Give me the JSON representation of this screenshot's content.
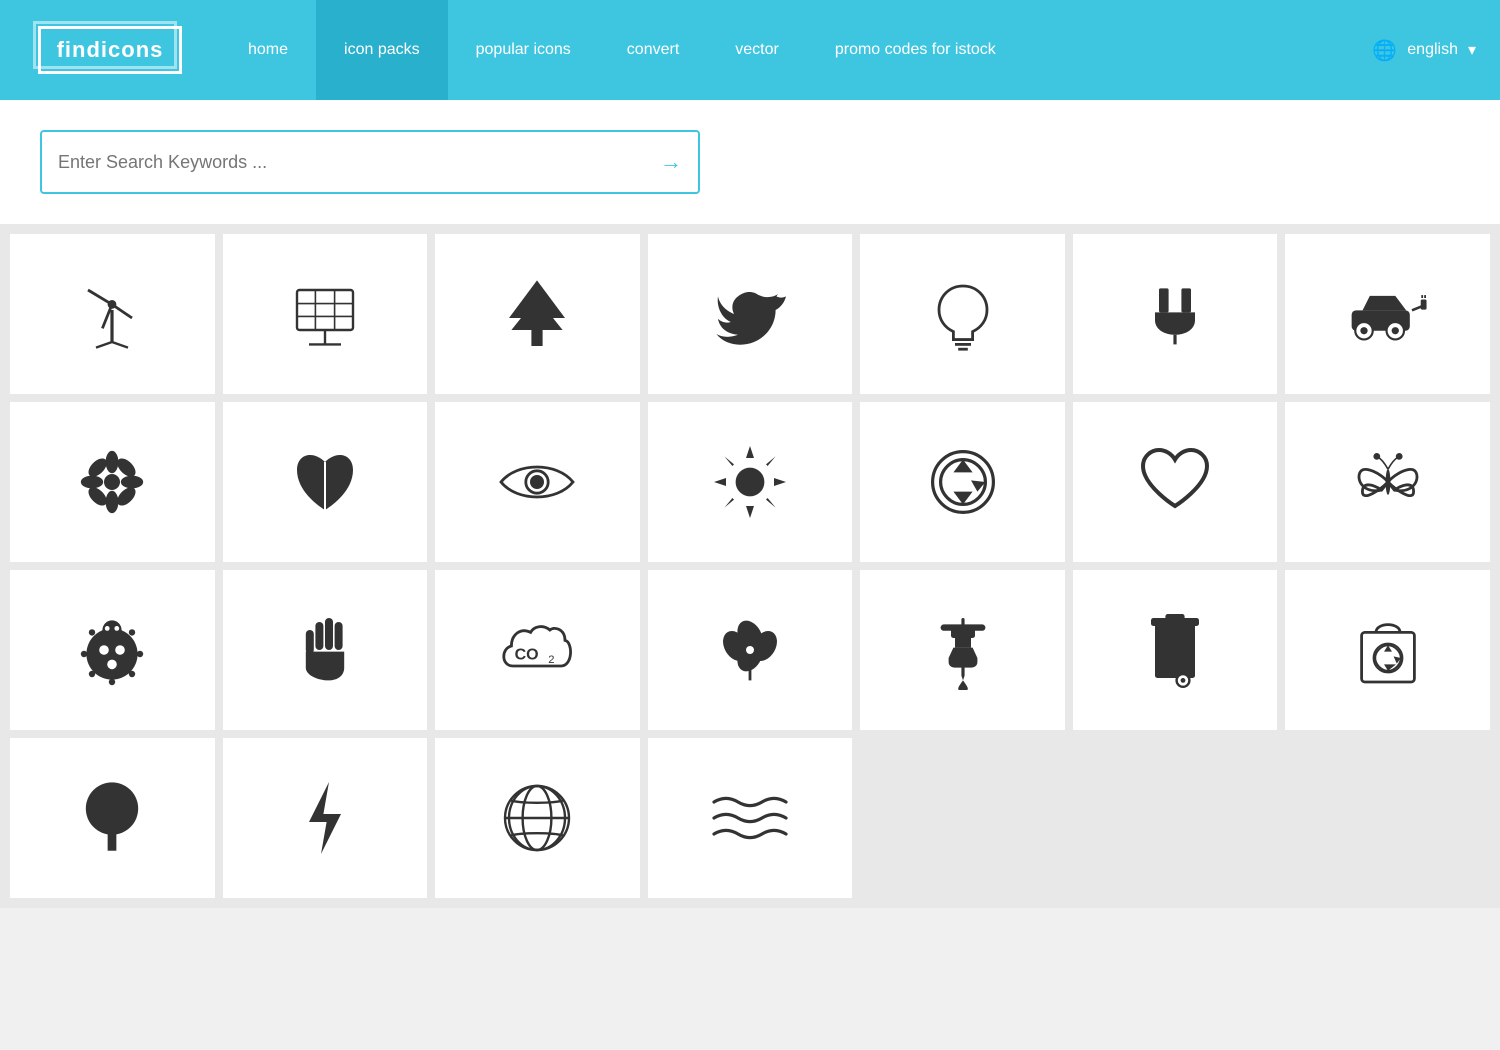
{
  "nav": {
    "logo": "findicons",
    "items": [
      {
        "label": "home",
        "active": false
      },
      {
        "label": "icon packs",
        "active": true
      },
      {
        "label": "popular icons",
        "active": false
      },
      {
        "label": "convert",
        "active": false
      },
      {
        "label": "vector",
        "active": false
      },
      {
        "label": "promo codes for istock",
        "active": false
      }
    ],
    "language": "english"
  },
  "search": {
    "placeholder": "Enter Search Keywords ..."
  },
  "icons": [
    "wind-turbine",
    "solar-panel",
    "tree",
    "bird",
    "lightbulb",
    "plug",
    "electric-car",
    "flower",
    "leaf",
    "eye",
    "sun",
    "recycle",
    "heart",
    "butterfly",
    "ladybug",
    "hand",
    "co2",
    "plant",
    "faucet",
    "trash-bin",
    "recycle-bag",
    "tree2",
    "lightning",
    "globe",
    "waves",
    "",
    "",
    ""
  ]
}
